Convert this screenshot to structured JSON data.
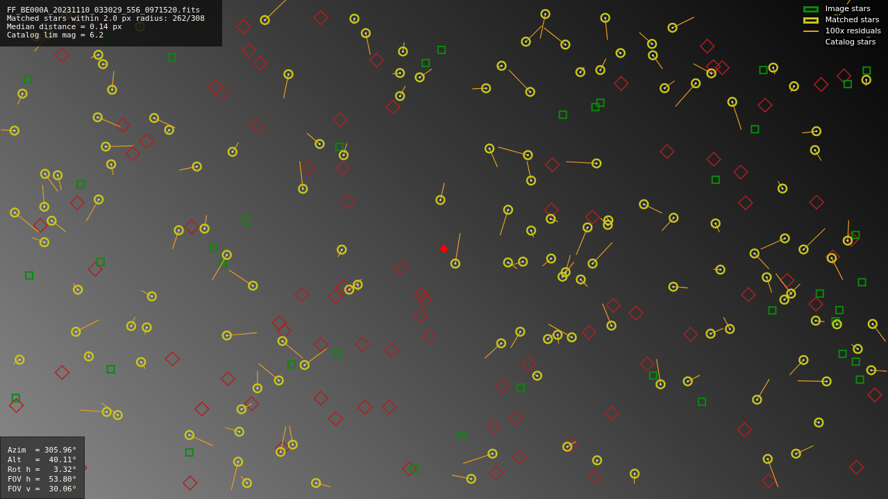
{
  "header": {
    "lines": [
      "FF_BE000A_20231110_033029_556_0971520.fits",
      "Matched stars within 2.0 px radius: 262/308",
      "Median distance = 0.14 px",
      "Catalog lim mag = 6.2"
    ]
  },
  "legend": [
    {
      "kind": "image",
      "label": "Image stars"
    },
    {
      "kind": "matched",
      "label": "Matched stars"
    },
    {
      "kind": "residual",
      "label": "100x residuals"
    },
    {
      "kind": "catalog",
      "label": "Catalog stars"
    }
  ],
  "pointing": {
    "lines": [
      "Azim  = 305.96°",
      "Alt   =  40.11°",
      "Rot h =   3.32°",
      "FOV h =  53.80°",
      "FOV v =  30.06°"
    ]
  }
}
